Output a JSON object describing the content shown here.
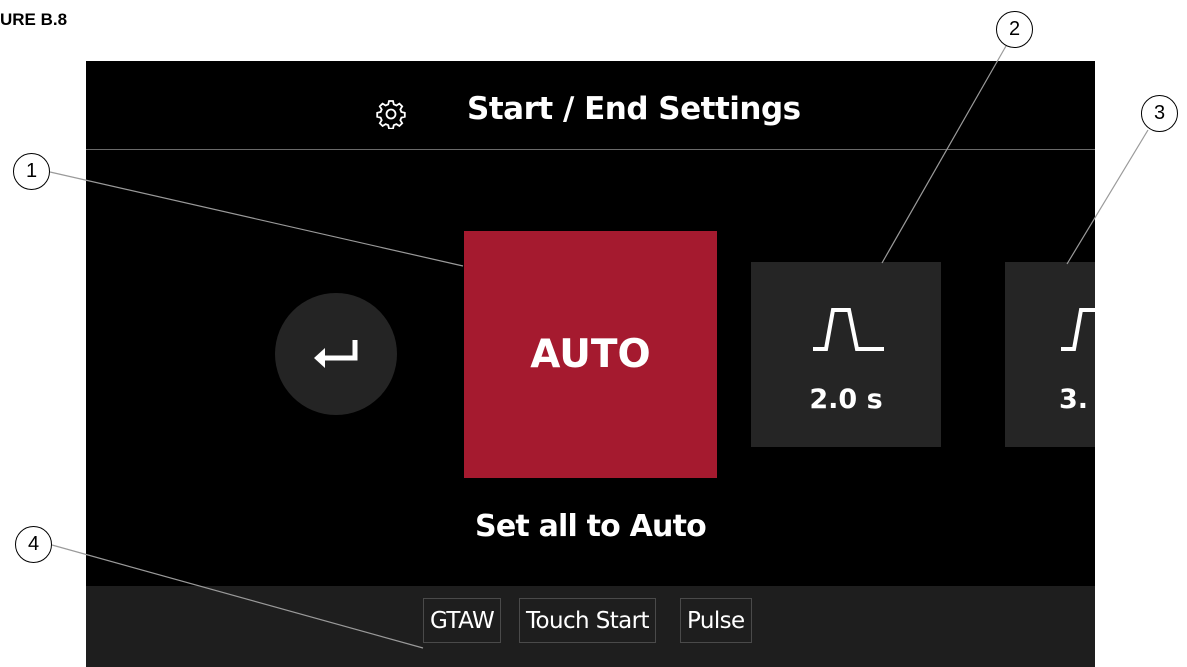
{
  "figure_label": "URE B.8",
  "header": {
    "title": "Start / End Settings",
    "icon": "gear-icon"
  },
  "back_button": {
    "icon": "return-arrow-icon"
  },
  "auto_tile": {
    "label": "AUTO",
    "caption": "Set all to Auto",
    "color": "#a51a2f"
  },
  "tiles": [
    {
      "icon": "ramp-pulse-icon",
      "value": "2.0 s"
    },
    {
      "icon": "ramp-pulse-icon",
      "value": "3."
    }
  ],
  "footer": {
    "chips": [
      "GTAW",
      "Touch Start",
      "Pulse"
    ]
  },
  "callouts": [
    "1",
    "2",
    "3",
    "4"
  ]
}
